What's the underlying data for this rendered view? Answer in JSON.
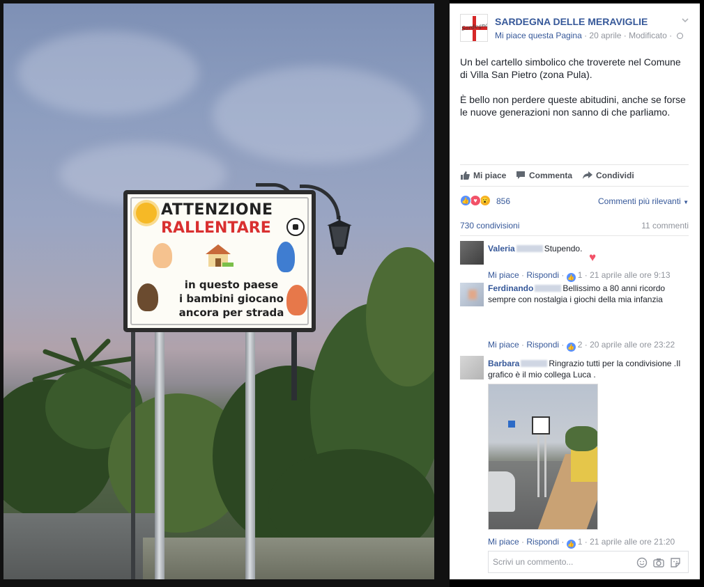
{
  "photo": {
    "sign_title_line1": "ATTENZIONE",
    "sign_title_line2": "RALLENTARE",
    "sign_body": [
      "in questo paese",
      "i bambini giocano",
      "ancora per strada"
    ]
  },
  "post": {
    "page_logo_text": "Sardegna",
    "page_name": "SARDEGNA DELLE MERAVIGLIE",
    "like_page": "Mi piace questa Pagina",
    "separator": " · ",
    "date": "20 aprile",
    "edited": "Modificato",
    "text_paragraphs": [
      "Un bel cartello simbolico che troverete nel Comune di Villa San Pietro (zona Pula).",
      "È bello non perdere queste abitudini, anche se forse le nuove generazioni non sanno di che parliamo."
    ]
  },
  "actions": {
    "like": "Mi piace",
    "comment": "Commenta",
    "share": "Condividi"
  },
  "stats": {
    "reactions_count": "856",
    "sort_label": "Commenti più rilevanti",
    "shares": "730 condivisioni",
    "comments": "11 commenti"
  },
  "comments": [
    {
      "name": "Valeria",
      "text": "Stupendo.",
      "like_label": "Mi piace",
      "reply_label": "Rispondi",
      "likes": "1",
      "time": "21 aprile alle ore 9:13"
    },
    {
      "name": "Ferdinando",
      "text": "Bellissimo a 80 anni ricordo sempre con nostalgia i giochi della mia infanzia",
      "like_label": "Mi piace",
      "reply_label": "Rispondi",
      "likes": "2",
      "time": "20 aprile alle ore 23:22"
    },
    {
      "name": "Barbara",
      "text": "Ringrazio tutti per la condivisione .Il grafico è il mio collega Luca .",
      "like_label": "Mi piace",
      "reply_label": "Rispondi",
      "likes": "1",
      "time": "21 aprile alle ore 21:20"
    }
  ],
  "composer": {
    "placeholder": "Scrivi un commento..."
  },
  "colors": {
    "link": "#365899",
    "muted": "#90949c",
    "like_blue": "#5890ff",
    "love_red": "#f25268",
    "wow_yellow": "#f7b125"
  },
  "icons": [
    "thumbs-up-icon",
    "comment-icon",
    "share-icon",
    "smiley-icon",
    "camera-icon",
    "sticker-icon",
    "chevron-down-icon",
    "globe-icon",
    "heart-icon"
  ]
}
